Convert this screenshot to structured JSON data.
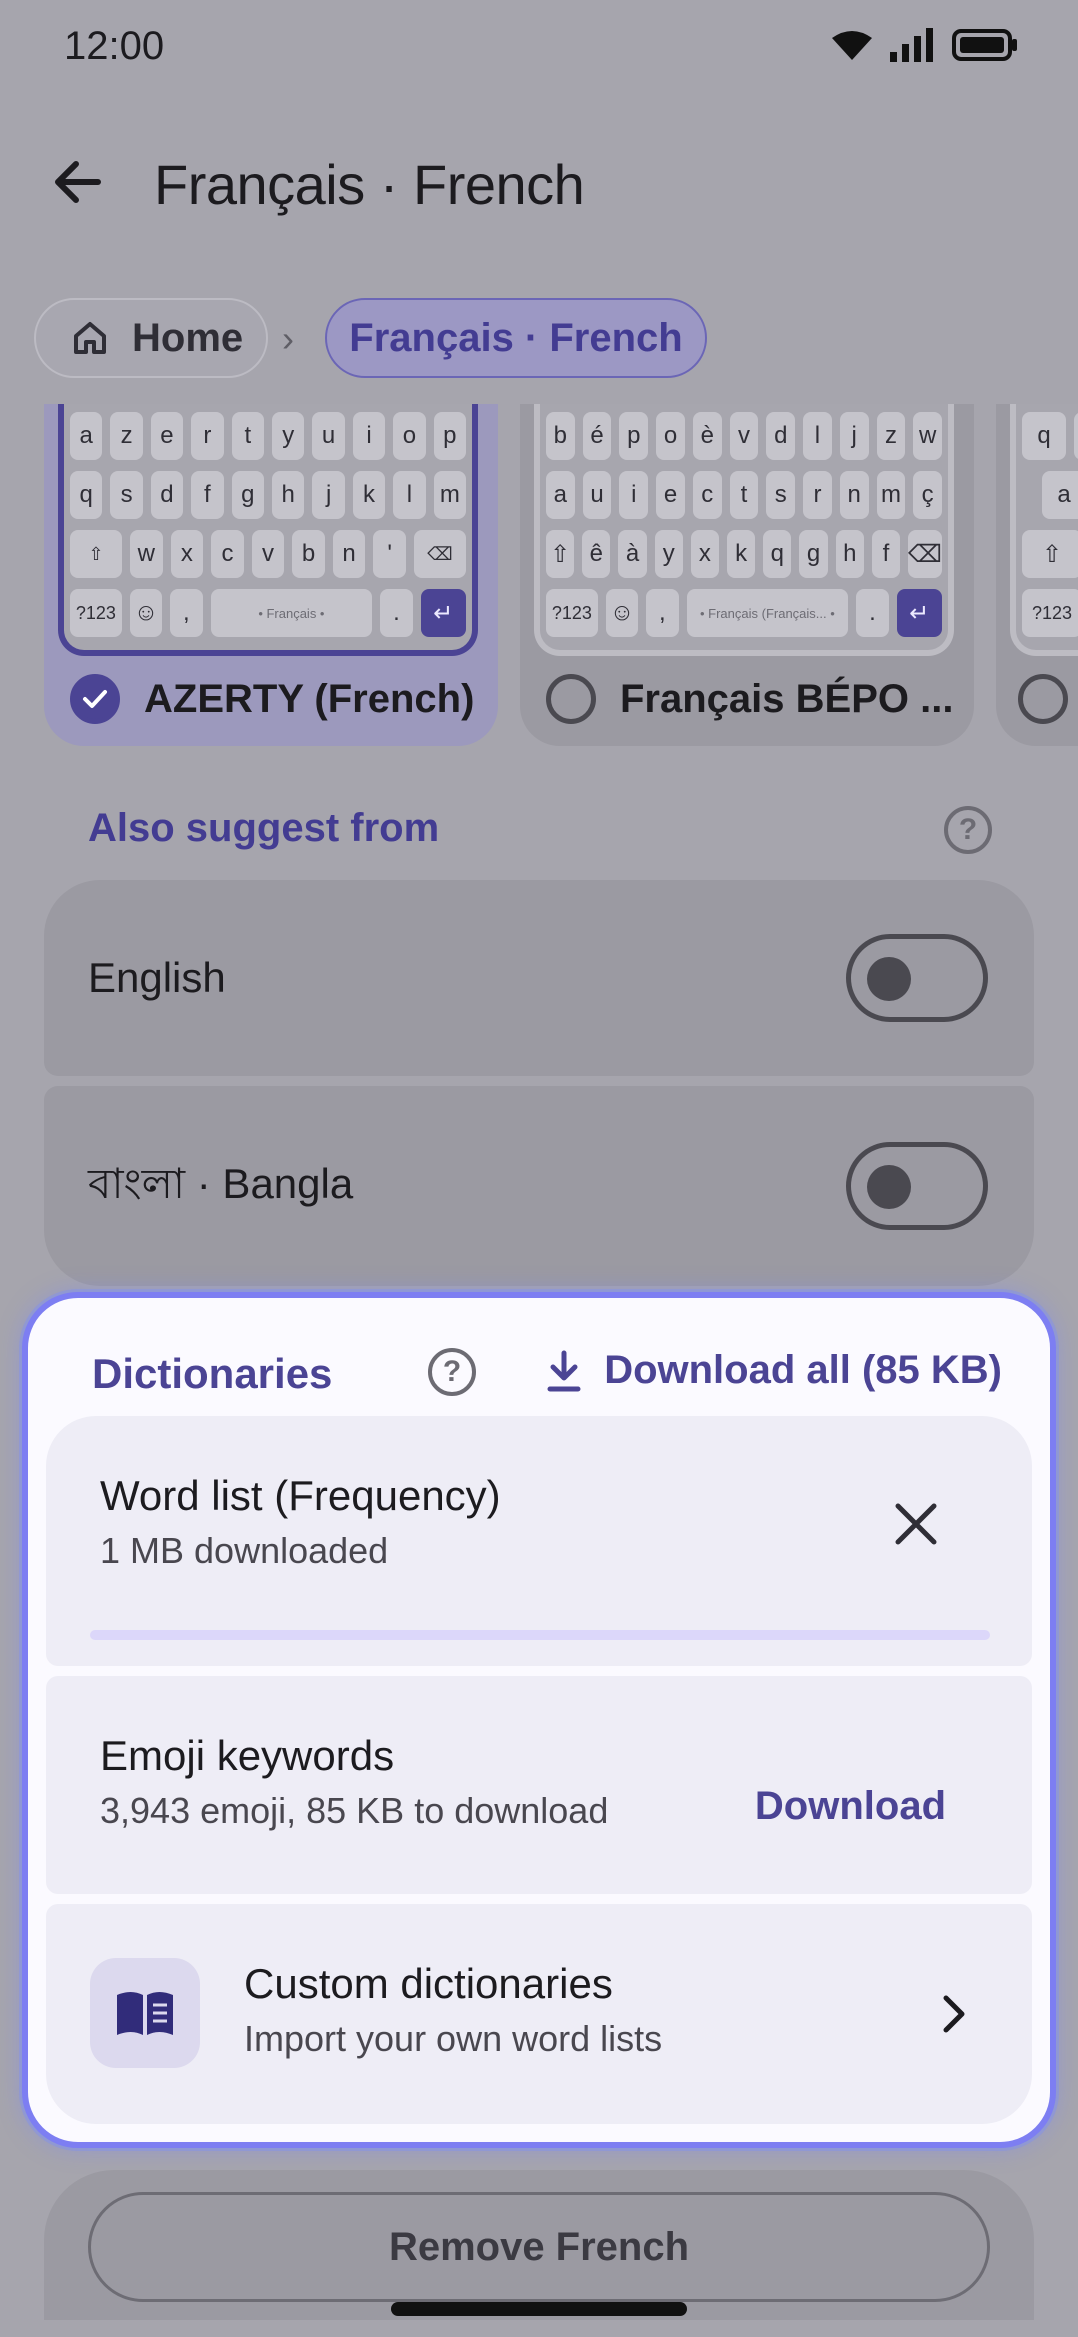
{
  "status_bar": {
    "time": "12:00",
    "icons": [
      "wifi-icon",
      "signal-icon",
      "battery-icon"
    ]
  },
  "top_bar": {
    "title": "Français · French"
  },
  "breadcrumb": {
    "home_label": "Home",
    "current_label": "Français · French"
  },
  "layouts": {
    "items": [
      {
        "name": "AZERTY (French)",
        "selected": true,
        "rows": [
          [
            "a",
            "z",
            "e",
            "r",
            "t",
            "y",
            "u",
            "i",
            "o",
            "p"
          ],
          [
            "q",
            "s",
            "d",
            "f",
            "g",
            "h",
            "j",
            "k",
            "l",
            "m"
          ],
          [
            "⇧",
            "w",
            "x",
            "c",
            "v",
            "b",
            "n",
            "'",
            "⌫"
          ],
          [
            "?123",
            "☺",
            ",",
            "Français",
            ".",
            "↵"
          ]
        ]
      },
      {
        "name": "Français BÉPO ...",
        "selected": false,
        "rows": [
          [
            "b",
            "é",
            "p",
            "o",
            "è",
            "v",
            "d",
            "l",
            "j",
            "z",
            "w"
          ],
          [
            "a",
            "u",
            "i",
            "e",
            "c",
            "t",
            "s",
            "r",
            "n",
            "m",
            "ç"
          ],
          [
            "⇧",
            "ê",
            "à",
            "y",
            "x",
            "k",
            "q",
            "g",
            "h",
            "f",
            "⌫"
          ],
          [
            "?123",
            "☺",
            ",",
            "Français (Français...",
            ".",
            "↵"
          ]
        ]
      },
      {
        "name": "",
        "selected": false,
        "rows": [
          [
            "q",
            "w"
          ],
          [
            "a"
          ],
          [
            "⇧"
          ],
          [
            "?123"
          ]
        ]
      }
    ]
  },
  "also_suggest": {
    "label": "Also suggest from",
    "items": [
      {
        "label": "English",
        "enabled": false
      },
      {
        "label": "বাংলা · Bangla",
        "enabled": false
      }
    ]
  },
  "dictionaries": {
    "title": "Dictionaries",
    "download_all": "Download all (85 KB)",
    "word_list": {
      "title": "Word list (Frequency)",
      "subtitle": "1 MB downloaded",
      "progress": 0
    },
    "emoji": {
      "title": "Emoji keywords",
      "subtitle": "3,943 emoji, 85 KB to download",
      "action": "Download"
    },
    "custom": {
      "title": "Custom dictionaries",
      "subtitle": "Import your own word lists"
    }
  },
  "remove_button": "Remove French",
  "colors": {
    "accent": "#4b4494",
    "panel_border": "#7d7ef2",
    "scrim": "#a6a5ad"
  }
}
